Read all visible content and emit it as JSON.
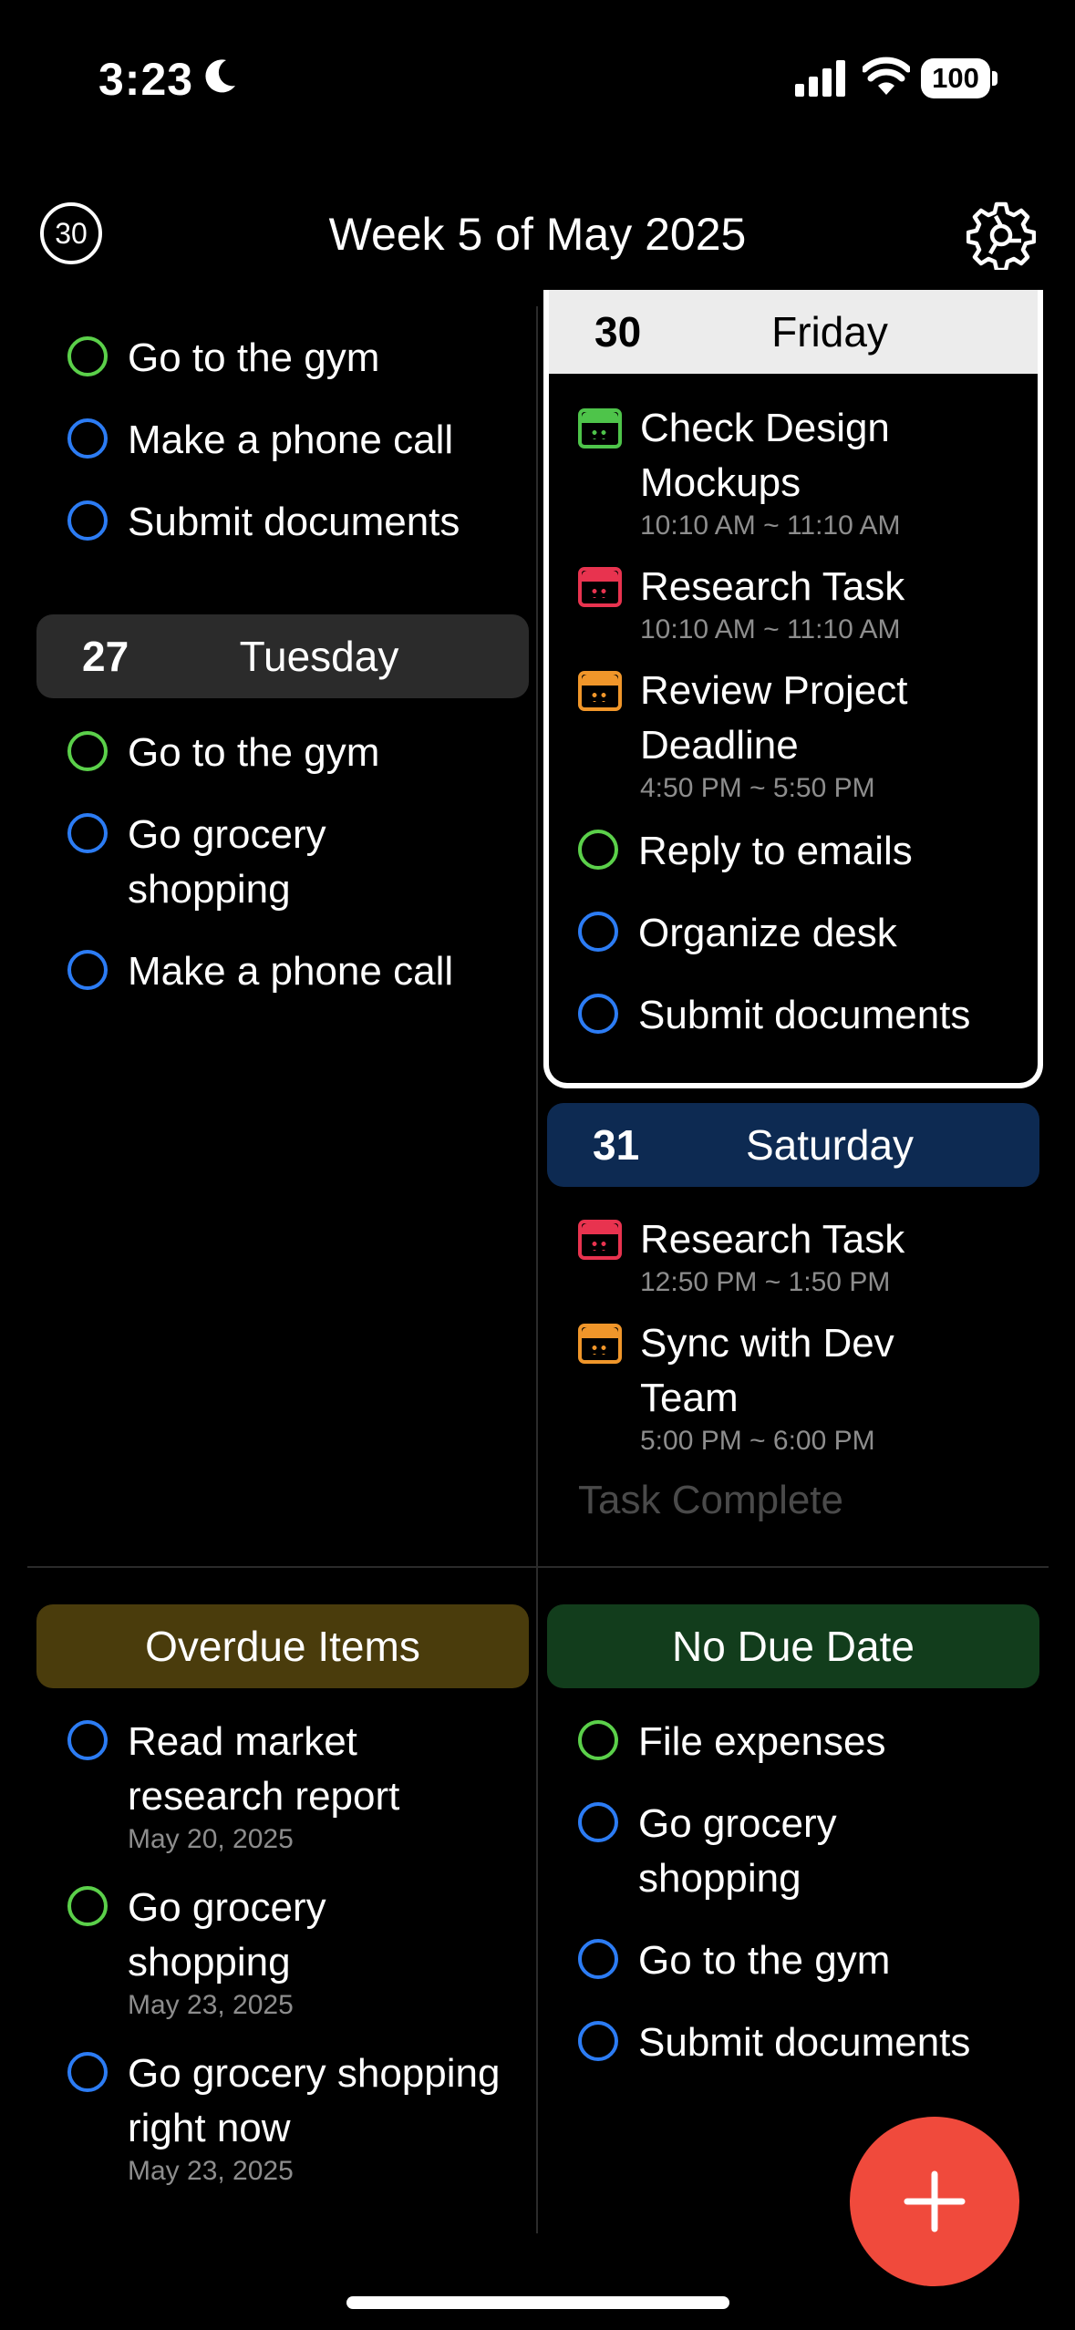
{
  "status_bar": {
    "time": "3:23",
    "battery": "100"
  },
  "header": {
    "today_badge": "30",
    "title": "Week 5 of May 2025"
  },
  "left_top_items": [
    {
      "label": "Go to the gym",
      "color": "green"
    },
    {
      "label": "Make a phone call",
      "color": "blue"
    },
    {
      "label": "Submit documents",
      "color": "blue"
    }
  ],
  "tuesday": {
    "num": "27",
    "name": "Tuesday",
    "items": [
      {
        "label": "Go to the gym",
        "color": "green"
      },
      {
        "label": "Go grocery shopping",
        "color": "blue"
      },
      {
        "label": "Make a phone call",
        "color": "blue"
      }
    ]
  },
  "friday": {
    "num": "30",
    "name": "Friday",
    "events": [
      {
        "title": "Check Design Mockups",
        "time": "10:10 AM ~ 11:10 AM",
        "color": "#4ec44a"
      },
      {
        "title": "Research Task",
        "time": "10:10 AM ~ 11:10 AM",
        "color": "#e8334f"
      },
      {
        "title": "Review Project Deadline",
        "time": "4:50 PM ~ 5:50 PM",
        "color": "#f0962a"
      }
    ],
    "items": [
      {
        "label": "Reply to emails",
        "color": "green"
      },
      {
        "label": "Organize desk",
        "color": "blue"
      },
      {
        "label": "Submit documents",
        "color": "blue"
      }
    ]
  },
  "saturday": {
    "num": "31",
    "name": "Saturday",
    "events": [
      {
        "title": "Research Task",
        "time": "12:50 PM ~ 1:50 PM",
        "color": "#e8334f"
      },
      {
        "title": "Sync with Dev Team",
        "time": "5:00 PM ~ 6:00 PM",
        "color": "#f0962a"
      }
    ],
    "footer": "Task Complete"
  },
  "overdue": {
    "title": "Overdue Items",
    "items": [
      {
        "label": "Read market research report",
        "date": "May 20, 2025",
        "color": "blue"
      },
      {
        "label": "Go grocery shopping",
        "date": "May 23, 2025",
        "color": "green"
      },
      {
        "label": "Go grocery shopping right now",
        "date": "May 23, 2025",
        "color": "blue"
      }
    ]
  },
  "no_due": {
    "title": "No Due Date",
    "items": [
      {
        "label": "File expenses",
        "color": "green"
      },
      {
        "label": "Go grocery shopping",
        "color": "blue"
      },
      {
        "label": "Go to the gym",
        "color": "blue"
      },
      {
        "label": "Submit documents",
        "color": "blue"
      }
    ]
  },
  "colors": {
    "tuesday_header": "#2b2b2b",
    "friday_header": "#ececec",
    "saturday_header": "#0d2a52",
    "overdue_header": "#4a3c0c",
    "no_due_header": "#123d1c",
    "fab": "#f04a3c"
  },
  "icons": [
    "moon-icon",
    "signal-icon",
    "wifi-icon",
    "gear-icon",
    "plus-icon",
    "calendar-icon",
    "circle-checkbox-icon"
  ]
}
